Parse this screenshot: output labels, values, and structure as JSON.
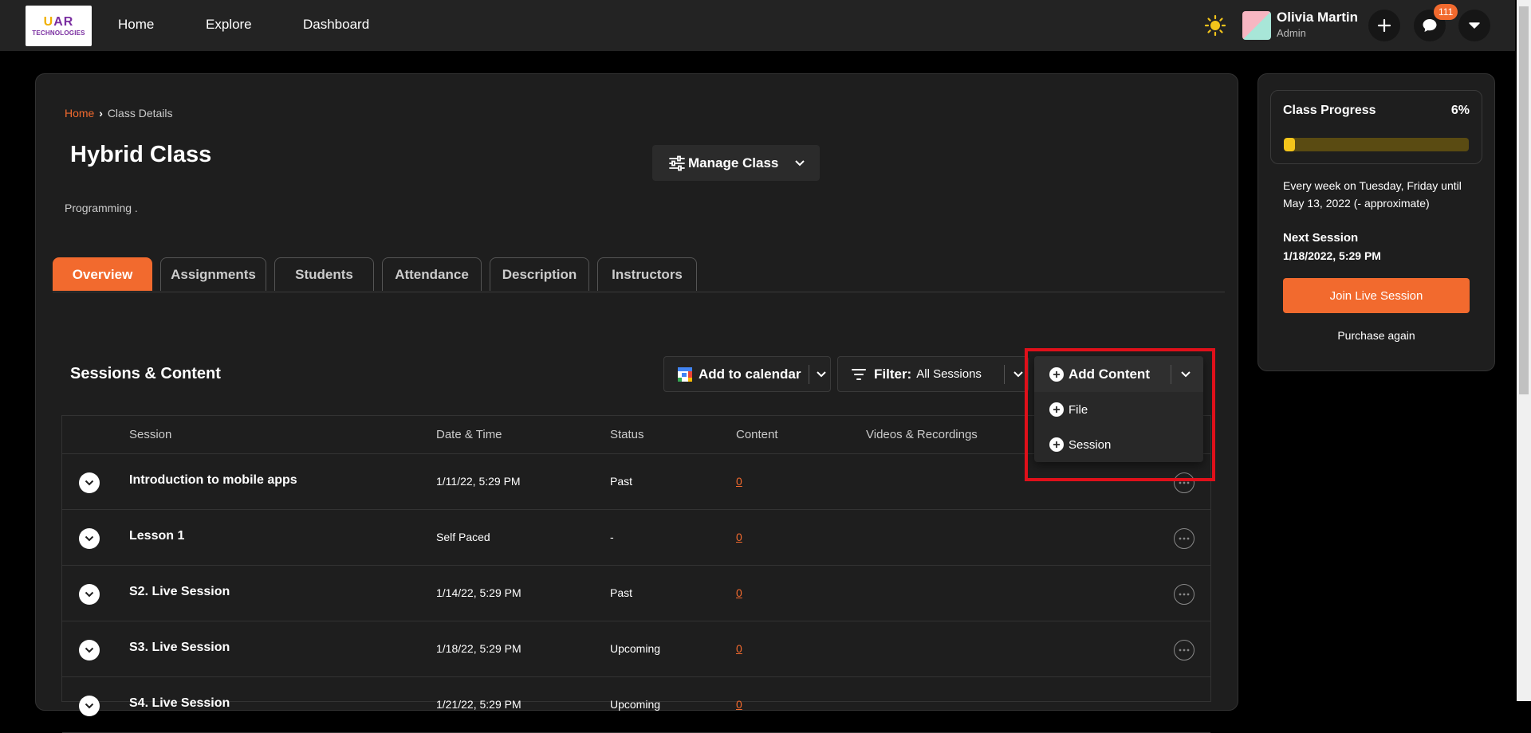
{
  "header": {
    "logo_line1_a": "U",
    "logo_line1_b": "A",
    "logo_line1_c": "R",
    "logo_line2": "TECHNOLOGIES",
    "nav": [
      "Home",
      "Explore",
      "Dashboard"
    ],
    "user_name": "Olivia Martin",
    "user_role": "Admin",
    "notification_count": "111"
  },
  "breadcrumb": {
    "home": "Home",
    "sep": "›",
    "current": "Class Details"
  },
  "class": {
    "title": "Hybrid Class",
    "category": "Programming",
    "category_dot": "."
  },
  "manage_button": "Manage Class",
  "tabs": [
    "Overview",
    "Assignments",
    "Students",
    "Attendance",
    "Description",
    "Instructors"
  ],
  "sessions": {
    "title": "Sessions & Content",
    "add_to_calendar": "Add to calendar",
    "filter_label": "Filter:",
    "filter_value": "All Sessions",
    "add_content": "Add Content",
    "menu_items": [
      "File",
      "Session"
    ],
    "columns": [
      "Session",
      "Date & Time",
      "Status",
      "Content",
      "Videos & Recordings"
    ],
    "rows": [
      {
        "name": "Introduction to mobile apps",
        "date": "1/11/22, 5:29 PM",
        "status": "Past",
        "content": "0"
      },
      {
        "name": "Lesson 1",
        "date": "Self Paced",
        "status": "-",
        "content": "0"
      },
      {
        "name": "S2. Live Session",
        "date": "1/14/22, 5:29 PM",
        "status": "Past",
        "content": "0"
      },
      {
        "name": "S3. Live Session",
        "date": "1/18/22, 5:29 PM",
        "status": "Upcoming",
        "content": "0"
      },
      {
        "name": "S4. Live Session",
        "date": "1/21/22, 5:29 PM",
        "status": "Upcoming",
        "content": "0"
      }
    ]
  },
  "progress": {
    "title": "Class Progress",
    "percent_label": "6%",
    "percent": 6,
    "schedule": "Every week on Tuesday, Friday until May 13, 2022 (- approximate)",
    "next_label": "Next Session",
    "next_value": "1/18/2022, 5:29 PM",
    "join_button": "Join Live Session",
    "purchase_link": "Purchase again"
  },
  "colors": {
    "accent": "#f26a2e",
    "progress_fill": "#f4c51b",
    "progress_track": "#5a4b12",
    "highlight": "#e0101a"
  }
}
